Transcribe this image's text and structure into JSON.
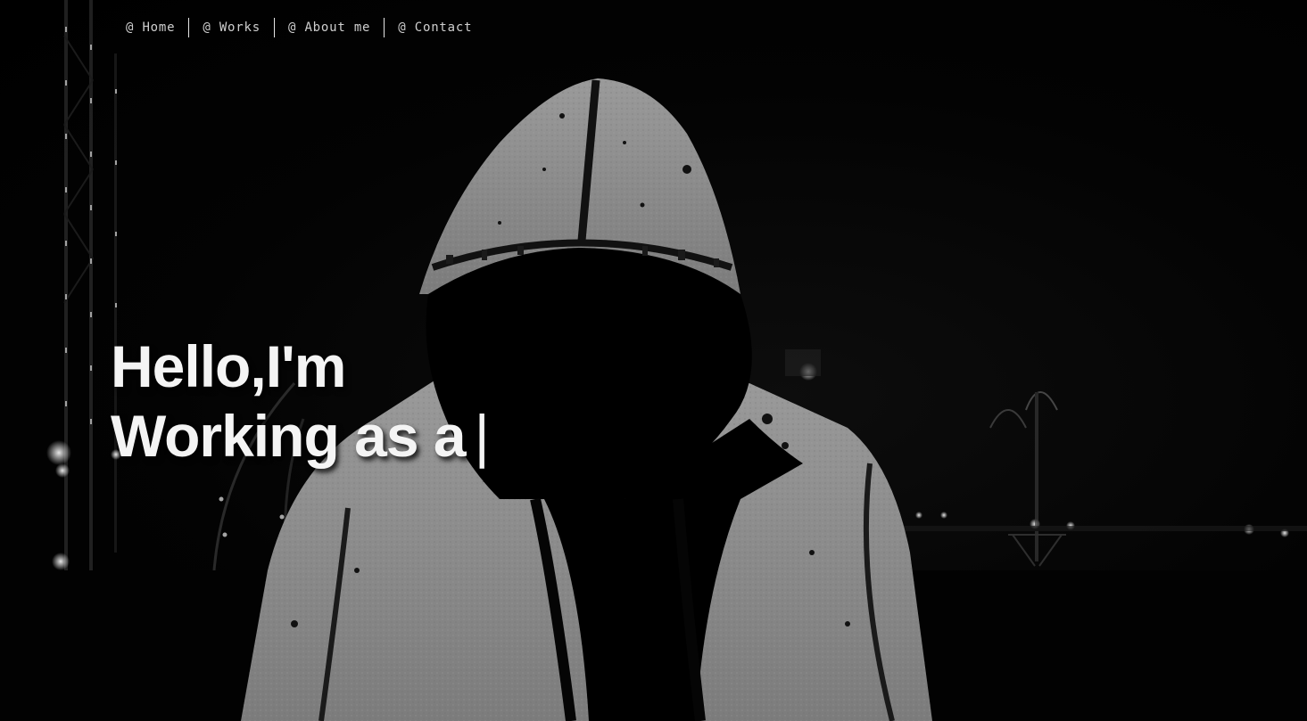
{
  "nav": {
    "items": [
      {
        "label": "@ Home"
      },
      {
        "label": "@ Works"
      },
      {
        "label": "@ About me"
      },
      {
        "label": "@ Contact"
      }
    ]
  },
  "hero": {
    "greeting": "Hello,I'm",
    "role_prefix": "Working as a",
    "cursor": "|"
  },
  "background": {
    "subject": "hooded-figure-silhouette",
    "scene": "night-city-grayscale"
  },
  "colors": {
    "background": "#000000",
    "text": "#f4f4f4",
    "nav_text": "#cfcfcf",
    "hoodie": "#8a8a8a"
  }
}
